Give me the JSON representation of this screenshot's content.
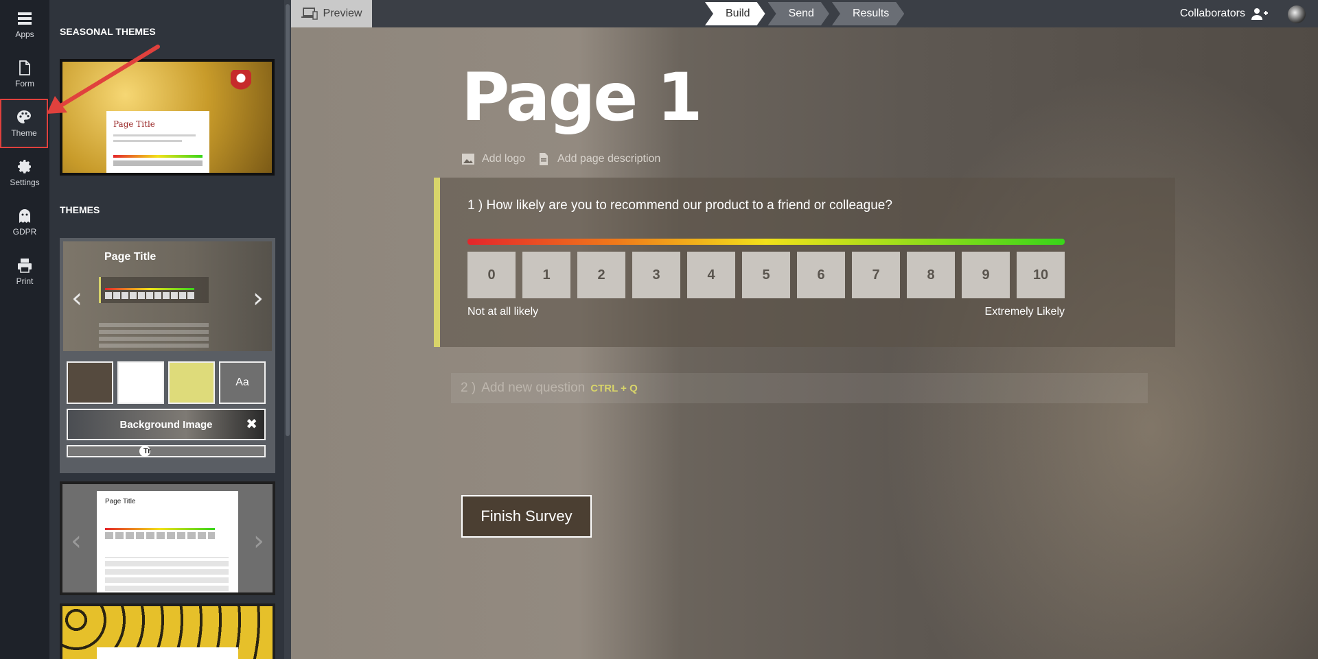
{
  "rail": {
    "items": [
      {
        "label": "Apps",
        "icon": "grid-icon"
      },
      {
        "label": "Form",
        "icon": "document-icon"
      },
      {
        "label": "Theme",
        "icon": "palette-icon",
        "active": true
      },
      {
        "label": "Settings",
        "icon": "gear-icon"
      },
      {
        "label": "GDPR",
        "icon": "ghost-icon"
      },
      {
        "label": "Print",
        "icon": "printer-icon"
      }
    ]
  },
  "panel": {
    "seasonal_heading": "SEASONAL THEMES",
    "themes_heading": "THEMES",
    "seasonal_preview_title": "Page Title",
    "theme_preview_title": "Page Title",
    "theme2_preview_title": "Page Title",
    "font_swatch_label": "Aa",
    "background_image_label": "Background Image",
    "slider_knob_label": "Tr",
    "swatch_colors": [
      "#554a3e",
      "#ffffff",
      "#dedb7a"
    ]
  },
  "topbar": {
    "preview_label": "Preview",
    "steps": [
      "Build",
      "Send",
      "Results"
    ],
    "active_step": "Build",
    "collaborators_label": "Collaborators"
  },
  "survey": {
    "page_title": "Page 1",
    "add_logo": "Add logo",
    "add_description": "Add page description",
    "question": {
      "number": "1 )",
      "text": "How likely are you to recommend our product to a friend or colleague?",
      "scale": [
        "0",
        "1",
        "2",
        "3",
        "4",
        "5",
        "6",
        "7",
        "8",
        "9",
        "10"
      ],
      "low_label": "Not at all likely",
      "high_label": "Extremely Likely"
    },
    "new_question": {
      "number": "2 )",
      "placeholder": "Add new question",
      "shortcut": "CTRL + Q"
    },
    "finish_label": "Finish Survey"
  },
  "colors": {
    "accent_border": "#d8d46a",
    "annotation": "#e0413d",
    "finish_bg": "#4b3f32"
  }
}
